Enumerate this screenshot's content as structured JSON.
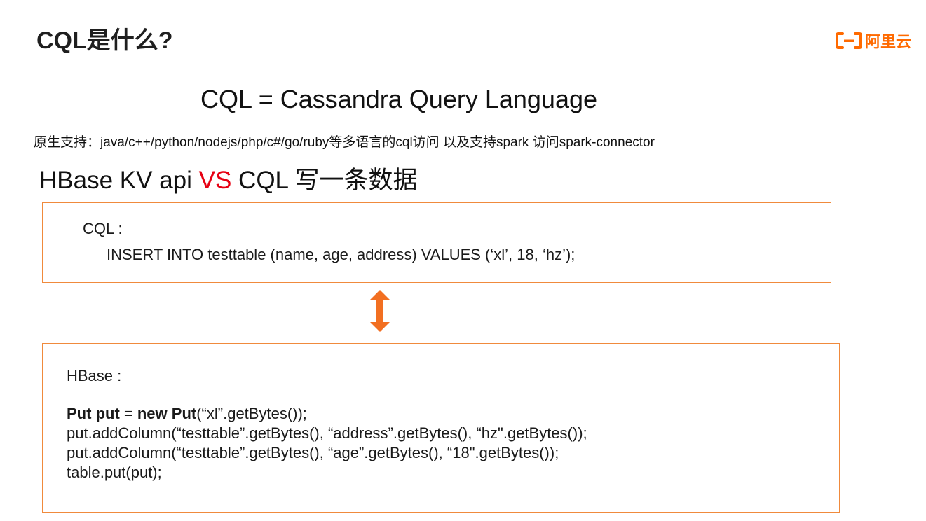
{
  "slide": {
    "title": "CQL是什么?"
  },
  "logo": {
    "icon": "aliyun-bracket-icon",
    "text": "阿里云",
    "color": "#ff6a00"
  },
  "headline": "CQL = Cassandra Query Language",
  "support_line": "原生支持：java/c++/python/nodejs/php/c#/go/ruby等多语言的cql访问 以及支持spark 访问spark-connector",
  "comparison": {
    "left": "HBase KV api ",
    "vs": "VS",
    "right": " CQL 写一条数据",
    "vs_color": "#e60012"
  },
  "cql_box": {
    "label": "CQL :",
    "code": "INSERT INTO testtable (name, age, address) VALUES (‘xl’, 18, ‘hz’);"
  },
  "arrow": {
    "icon": "double-arrow-vertical-icon",
    "color": "#f26f21"
  },
  "hbase_box": {
    "label": "HBase :",
    "line1": {
      "kw1": "Put",
      "sp1": " ",
      "kw2": "put",
      "eq": " = ",
      "kw3": "new",
      "sp2": " ",
      "kw4": "Put",
      "rest": "(“xl”.getBytes());"
    },
    "line2": "put.addColumn(“testtable”.getBytes(), “address”.getBytes(), “hz\".getBytes());",
    "line3": "put.addColumn(“testtable”.getBytes(), “age”.getBytes(), “18\".getBytes());",
    "line4": "table.put(put);"
  },
  "border_color": "#f08a3c"
}
